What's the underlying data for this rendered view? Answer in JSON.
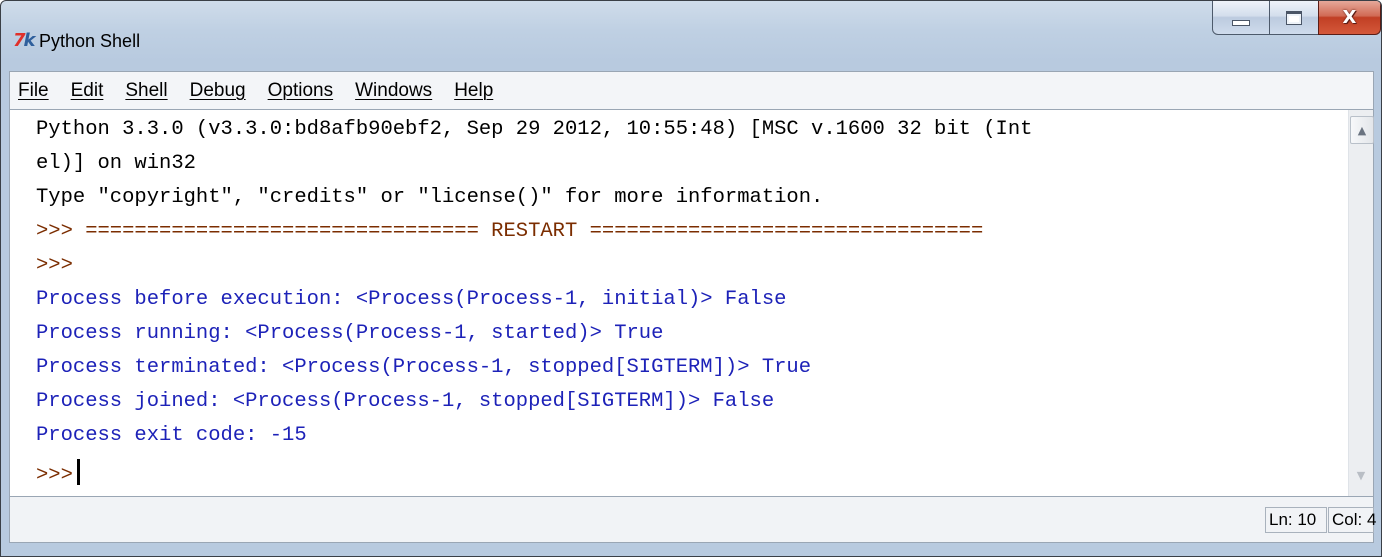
{
  "window": {
    "title": "Python Shell",
    "icon_glyphs": {
      "seven": "7",
      "k": "k"
    },
    "controls": {
      "minimize": "minimize",
      "maximize": "maximize",
      "close": "X"
    }
  },
  "menubar": {
    "items": [
      "File",
      "Edit",
      "Shell",
      "Debug",
      "Options",
      "Windows",
      "Help"
    ]
  },
  "shell": {
    "lines": [
      {
        "text": "Python 3.3.0 (v3.3.0:bd8afb90ebf2, Sep 29 2012, 10:55:48) [MSC v.1600 32 bit (Int",
        "kind": "plain"
      },
      {
        "text": "el)] on win32",
        "kind": "plain"
      },
      {
        "text": "Type \"copyright\", \"credits\" or \"license()\" for more information.",
        "kind": "plain"
      },
      {
        "text": ">>> ================================ RESTART ================================",
        "kind": "prompt"
      },
      {
        "text": ">>>",
        "kind": "prompt"
      },
      {
        "text": "Process before execution: <Process(Process-1, initial)> False",
        "kind": "output"
      },
      {
        "text": "Process running: <Process(Process-1, started)> True",
        "kind": "output"
      },
      {
        "text": "Process terminated: <Process(Process-1, stopped[SIGTERM])> True",
        "kind": "output"
      },
      {
        "text": "Process joined: <Process(Process-1, stopped[SIGTERM])> False",
        "kind": "output"
      },
      {
        "text": "Process exit code: -15",
        "kind": "output"
      },
      {
        "text": ">>>",
        "kind": "prompt",
        "has_cursor": true
      }
    ]
  },
  "statusbar": {
    "line": "Ln: 10",
    "column": "Col: 4"
  },
  "colors": {
    "prompt": "#7b2d00",
    "output": "#1d22b8",
    "plain": "#000000"
  }
}
